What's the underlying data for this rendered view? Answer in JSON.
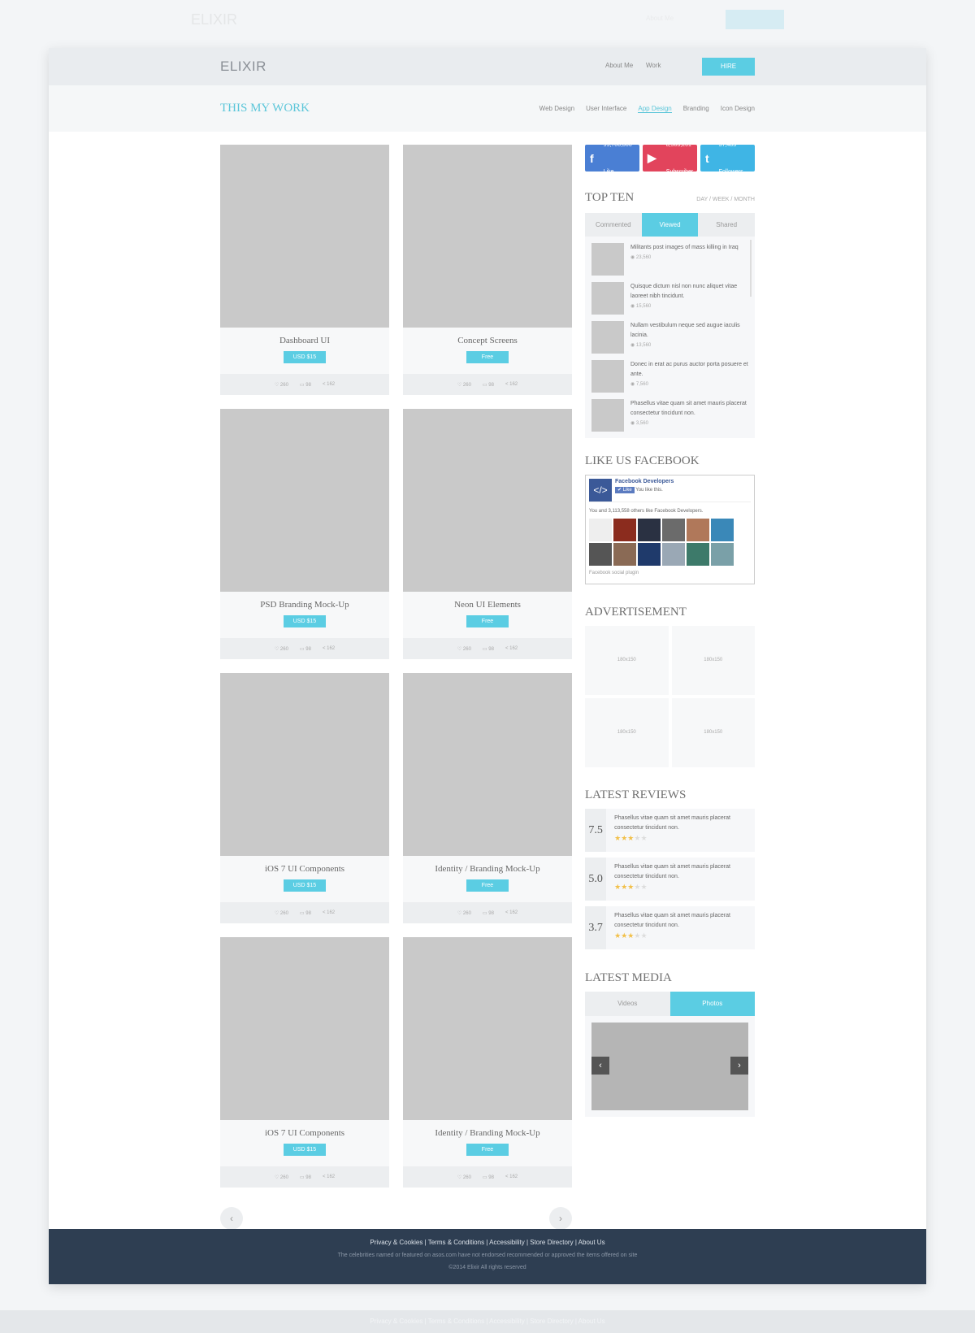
{
  "brand": "ELIXIR",
  "nav": {
    "about": "About Me",
    "work": "Work",
    "hire": "HIRE"
  },
  "section_title": "THIS MY WORK",
  "categories": [
    "Web Design",
    "User Interface",
    "App Design",
    "Branding",
    "Icon Design"
  ],
  "active_category": "App Design",
  "cards": [
    {
      "title": "Dashboard UI",
      "price": "USD $15"
    },
    {
      "title": "Concept Screens",
      "price": "Free"
    },
    {
      "title": "PSD Branding Mock-Up",
      "price": "USD $15"
    },
    {
      "title": "Neon UI Elements",
      "price": "Free"
    },
    {
      "title": "iOS 7 UI Components",
      "price": "USD $15"
    },
    {
      "title": "Identity / Branding Mock-Up",
      "price": "Free"
    },
    {
      "title": "iOS 7 UI Components",
      "price": "USD $15"
    },
    {
      "title": "Identity / Branding Mock-Up",
      "price": "Free"
    }
  ],
  "card_stats": {
    "likes": "260",
    "comments": "98",
    "shares": "162"
  },
  "pagination": {
    "prev": "‹",
    "next": "›"
  },
  "social": [
    {
      "count": "99,700,000",
      "label": "Like",
      "color": "#4a7fd4",
      "icon": "f"
    },
    {
      "count": "8,503,201",
      "label": "Subscriber",
      "color": "#e2445c",
      "icon": "▶"
    },
    {
      "count": "37,483",
      "label": "Followers",
      "color": "#3fb5e5",
      "icon": "t"
    }
  ],
  "top_ten": {
    "title": "TOP TEN",
    "periods": [
      "DAY",
      "WEEK",
      "MONTH"
    ],
    "tabs": [
      "Commented",
      "Viewed",
      "Shared"
    ],
    "active_tab": "Viewed",
    "items": [
      {
        "text": "Militants post images of mass killing in Iraq",
        "views": "23,560"
      },
      {
        "text": "Quisque dictum nisl non nunc aliquet vitae laoreet nibh tincidunt.",
        "views": "15,560"
      },
      {
        "text": "Nullam vestibulum neque sed augue iaculis lacinia.",
        "views": "13,560"
      },
      {
        "text": "Donec in erat ac purus auctor porta posuere et ante.",
        "views": "7,560"
      },
      {
        "text": "Phasellus vitae quam sit amet mauris placerat consectetur tincidunt non.",
        "views": "3,560"
      }
    ]
  },
  "facebook": {
    "title": "LIKE US FACEBOOK",
    "page": "Facebook Developers",
    "like": "✔ Like",
    "you_like": "You like this.",
    "others": "You and 3,113,558 others like Facebook Developers.",
    "plugin": "Facebook social plugin"
  },
  "ads": {
    "title": "ADVERTISEMENT",
    "slots": [
      "180x150",
      "180x150",
      "180x150",
      "180x150"
    ]
  },
  "reviews": {
    "title": "LATEST REVIEWS",
    "items": [
      {
        "score": "7.5",
        "text": "Phasellus vitae quam sit amet mauris placerat consectetur tincidunt non.",
        "stars": 3
      },
      {
        "score": "5.0",
        "text": "Phasellus vitae quam sit amet mauris placerat consectetur tincidunt non.",
        "stars": 3
      },
      {
        "score": "3.7",
        "text": "Phasellus vitae quam sit amet mauris placerat consectetur tincidunt non.",
        "stars": 3
      }
    ]
  },
  "media": {
    "title": "LATEST MEDIA",
    "tabs": [
      "Videos",
      "Photos"
    ],
    "active_tab": "Photos"
  },
  "footer": {
    "links": "Privacy & Cookies | Terms & Conditions | Accessibility | Store Directory | About Us",
    "disclaimer": "The celebrities named or featured on asos.com have not endorsed recommended or approved the items offered on site",
    "copyright": "©2014 Elixir All rights reserved"
  },
  "colors": {
    "accent": "#5bcde3",
    "footer": "#2e3e52"
  }
}
